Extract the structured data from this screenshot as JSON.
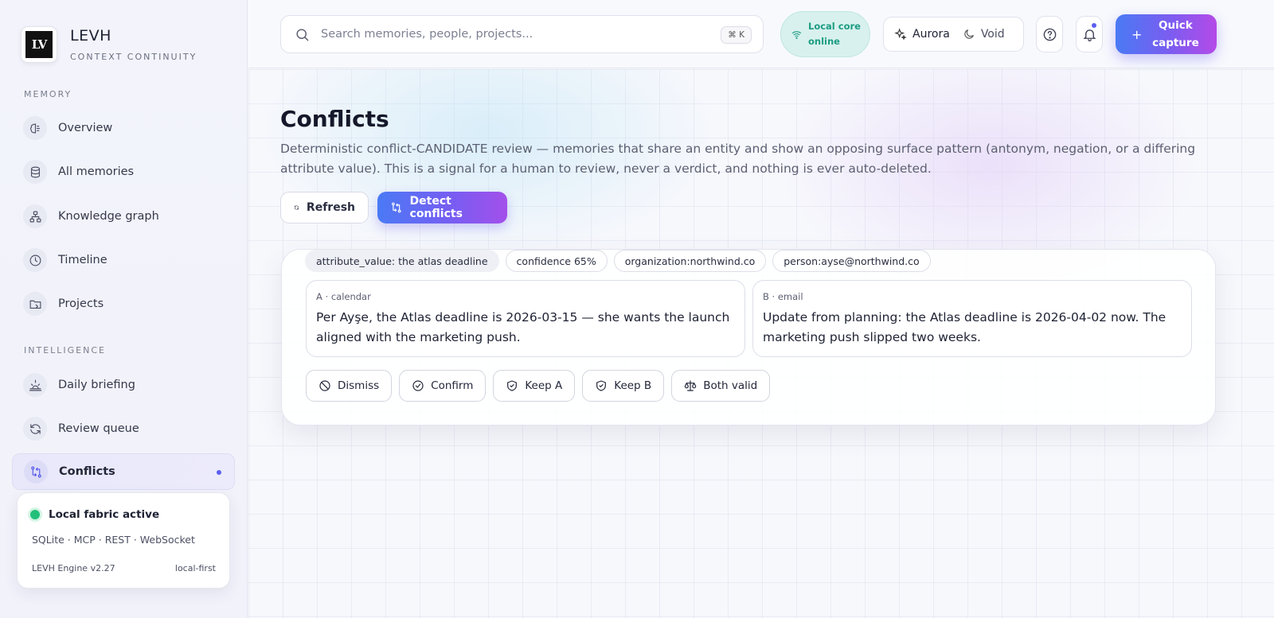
{
  "brand": {
    "logo_text": "LV",
    "name": "LEVH",
    "tagline": "CONTEXT CONTINUITY"
  },
  "sidebar": {
    "sections": [
      {
        "label": "MEMORY",
        "items": [
          {
            "label": "Overview",
            "icon": "brain-icon"
          },
          {
            "label": "All memories",
            "icon": "database-icon"
          },
          {
            "label": "Knowledge graph",
            "icon": "graph-icon"
          },
          {
            "label": "Timeline",
            "icon": "clock-icon"
          },
          {
            "label": "Projects",
            "icon": "folder-icon"
          }
        ]
      },
      {
        "label": "INTELLIGENCE",
        "items": [
          {
            "label": "Daily briefing",
            "icon": "sunrise-icon"
          },
          {
            "label": "Review queue",
            "icon": "refresh-icon"
          },
          {
            "label": "Conflicts",
            "icon": "conflict-icon",
            "active": true
          }
        ]
      }
    ],
    "status_card": {
      "title": "Local fabric active",
      "stack": "SQLite · MCP · REST · WebSocket",
      "version": "LEVH Engine v2.27",
      "mode": "local-first",
      "status_color": "#22c07a"
    }
  },
  "topbar": {
    "search": {
      "placeholder": "Search memories, people, projects...",
      "value": "",
      "shortcut": "⌘ K"
    },
    "core_status": {
      "line1": "Local core",
      "line2": "online",
      "color": "#1c9c82"
    },
    "theme": {
      "options": [
        {
          "label": "Aurora",
          "icon": "sparkle-icon",
          "selected": true
        },
        {
          "label": "Void",
          "icon": "moon-icon",
          "selected": false
        }
      ]
    },
    "quick_capture": {
      "icon": "+",
      "label": "Quick capture"
    }
  },
  "page": {
    "title": "Conflicts",
    "description": "Deterministic conflict-CANDIDATE review — memories that share an entity and show an opposing surface pattern (antonym, negation, or a differing attribute value). This is a signal for a human to review, never a verdict, and nothing is ever auto-deleted.",
    "buttons": {
      "refresh": "Refresh",
      "detect": "Detect conflicts"
    }
  },
  "conflicts": [
    {
      "tags": [
        "attribute_value: the atlas deadline",
        "confidence 65%",
        "organization:northwind.co",
        "person:ayse@northwind.co"
      ],
      "a": {
        "source": "A · calendar",
        "text": "Per Ayşe, the Atlas deadline is 2026-03-15 — she wants the launch aligned with the marketing push."
      },
      "b": {
        "source": "B · email",
        "text": "Update from planning: the Atlas deadline is 2026-04-02 now. The marketing push slipped two weeks."
      },
      "actions": {
        "dismiss": "Dismiss",
        "confirm": "Confirm",
        "keep_a": "Keep A",
        "keep_b": "Keep B",
        "both_valid": "Both valid"
      }
    }
  ],
  "colors": {
    "accent": "#5c5ff0",
    "gradient_start": "#4a7af5",
    "gradient_end": "#b54ae8"
  }
}
